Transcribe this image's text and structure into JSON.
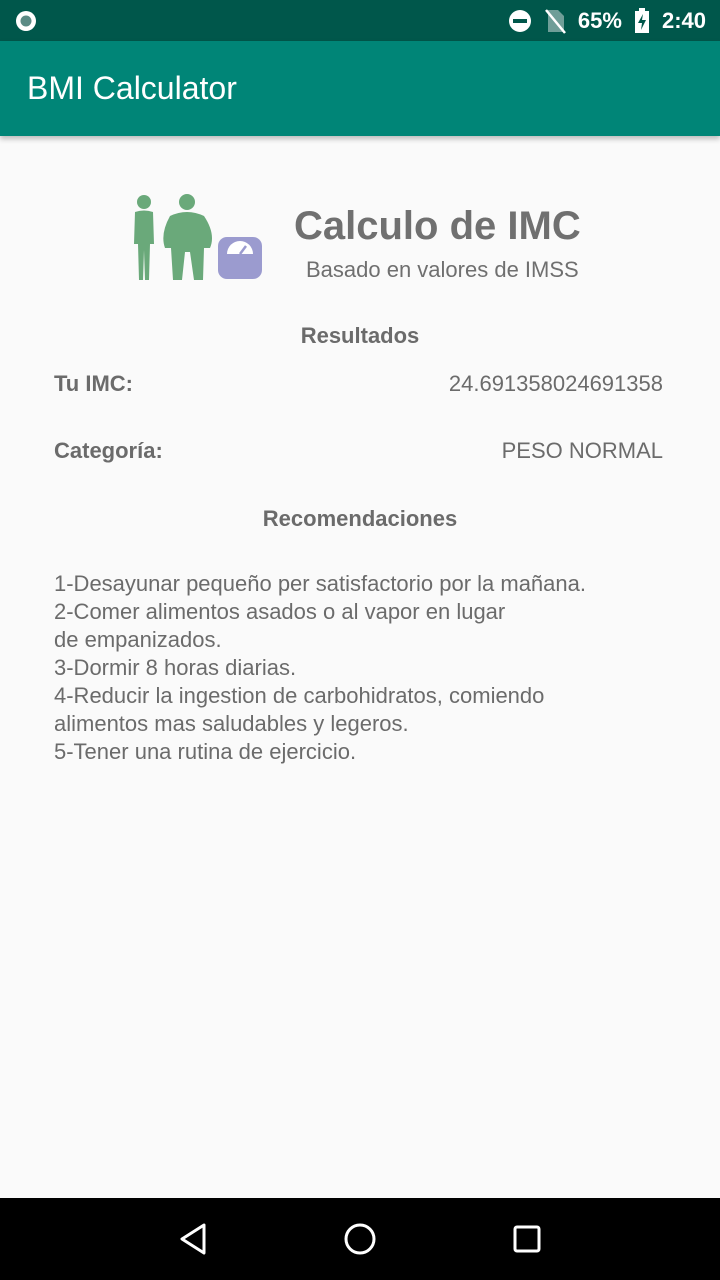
{
  "status_bar": {
    "battery": "65%",
    "time": "2:40",
    "icons": [
      "notification-dot-icon",
      "do-not-disturb-icon",
      "no-sim-icon",
      "battery-charging-icon"
    ]
  },
  "app_bar": {
    "title": "BMI Calculator"
  },
  "header": {
    "illustration": "people-with-scale-icon",
    "title": "Calculo de IMC",
    "subtitle": "Basado en valores de IMSS"
  },
  "results": {
    "section_title": "Resultados",
    "imc_label": "Tu IMC:",
    "imc_value": "24.691358024691358",
    "category_label": "Categoría:",
    "category_value": "PESO NORMAL"
  },
  "recommendations": {
    "section_title": "Recomendaciones",
    "lines": [
      "1-Desayunar pequeño per satisfactorio por la mañana.",
      "2-Comer alimentos asados o al vapor en lugar",
      "de empanizados.",
      "3-Dormir 8 horas diarias.",
      "4-Reducir la ingestion de carbohidratos, comiendo",
      "alimentos mas saludables y legeros.",
      "5-Tener una rutina de ejercicio."
    ]
  },
  "nav_bar": {
    "buttons": [
      "back-icon",
      "home-icon",
      "recents-icon"
    ]
  },
  "colors": {
    "status_bar": "#00574b",
    "app_bar": "#008577",
    "people": "#6aa97a",
    "scale": "#9b9bcf"
  }
}
